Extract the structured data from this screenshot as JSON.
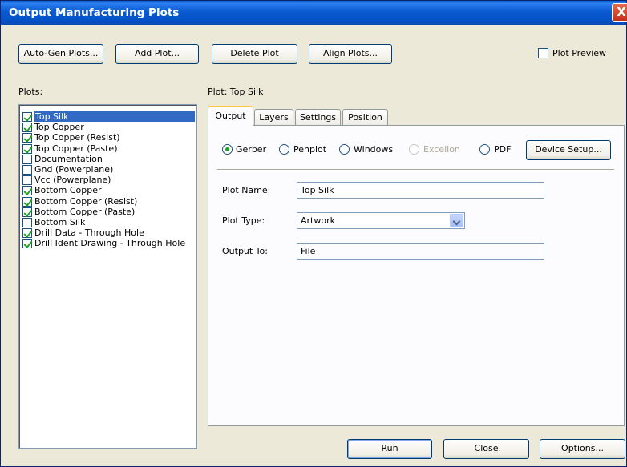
{
  "window": {
    "title": "Output Manufacturing Plots",
    "close_glyph": "X"
  },
  "toolbar": {
    "autogen_label": "Auto-Gen Plots...",
    "add_label": "Add Plot...",
    "delete_label": "Delete Plot",
    "align_label": "Align Plots...",
    "preview_label": "Plot Preview",
    "preview_checked": false
  },
  "plots": {
    "label": "Plots:",
    "items": [
      {
        "name": "Top Silk",
        "checked": true,
        "selected": true
      },
      {
        "name": "Top Copper",
        "checked": true
      },
      {
        "name": "Top Copper (Resist)",
        "checked": true
      },
      {
        "name": "Top Copper (Paste)",
        "checked": true
      },
      {
        "name": "Documentation",
        "checked": false
      },
      {
        "name": "Gnd (Powerplane)",
        "checked": false
      },
      {
        "name": "Vcc (Powerplane)",
        "checked": false
      },
      {
        "name": "Bottom Copper",
        "checked": true
      },
      {
        "name": "Bottom Copper (Resist)",
        "checked": true
      },
      {
        "name": "Bottom Copper (Paste)",
        "checked": true
      },
      {
        "name": "Bottom Silk",
        "checked": false
      },
      {
        "name": "Drill Data - Through Hole",
        "checked": true
      },
      {
        "name": "Drill Ident Drawing - Through Hole",
        "checked": true
      }
    ]
  },
  "detail": {
    "heading": "Plot: Top Silk",
    "tabs": [
      "Output",
      "Layers",
      "Settings",
      "Position"
    ],
    "active_tab": "Output",
    "output_types": [
      {
        "label": "Gerber",
        "selected": true,
        "enabled": true
      },
      {
        "label": "Penplot",
        "selected": false,
        "enabled": true
      },
      {
        "label": "Windows",
        "selected": false,
        "enabled": true
      },
      {
        "label": "Excellon",
        "selected": false,
        "enabled": false
      },
      {
        "label": "PDF",
        "selected": false,
        "enabled": true
      }
    ],
    "device_setup_label": "Device Setup...",
    "plot_name_label": "Plot Name:",
    "plot_name_value": "Top Silk",
    "plot_type_label": "Plot Type:",
    "plot_type_value": "Artwork",
    "output_to_label": "Output To:",
    "output_to_value": "File"
  },
  "footer": {
    "run_label": "Run",
    "close_label": "Close",
    "options_label": "Options..."
  }
}
